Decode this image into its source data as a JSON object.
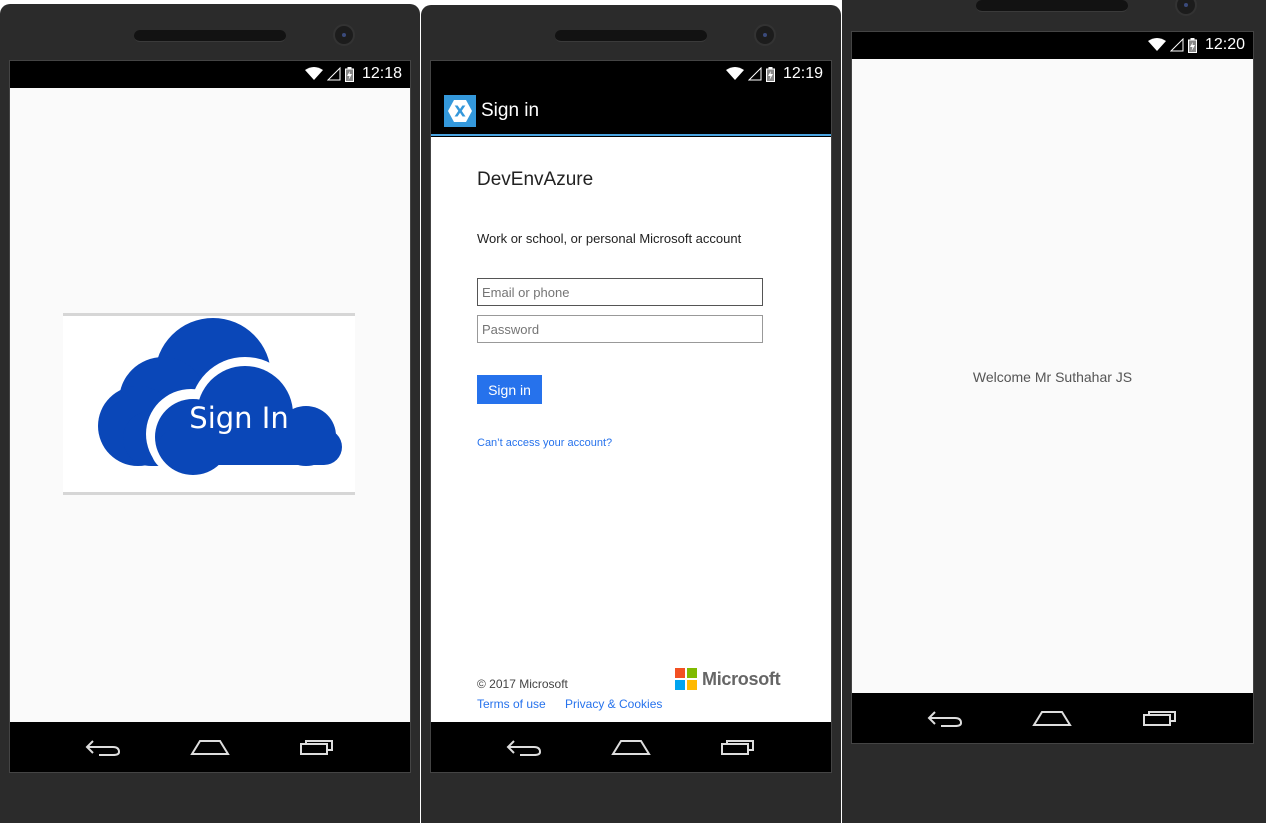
{
  "phones": [
    {
      "status": {
        "time": "12:18"
      },
      "signin_image": {
        "text": "Sign In",
        "cloud_color": "#0a47b8"
      }
    },
    {
      "status": {
        "time": "12:19"
      },
      "appbar": {
        "title": "Sign in",
        "logo_letter": "X",
        "logo_color": "#3498db"
      },
      "login": {
        "tenant": "DevEnvAzure",
        "account_desc": "Work or school, or personal Microsoft account",
        "email_placeholder": "Email or phone",
        "password_placeholder": "Password",
        "signin_label": "Sign in",
        "cant_access": "Can’t access your account?",
        "copyright": "© 2017 Microsoft",
        "terms": "Terms of use",
        "privacy": "Privacy & Cookies",
        "brand": "Microsoft",
        "accent": "#2672ec"
      }
    },
    {
      "status": {
        "time": "12:20"
      },
      "welcome": "Welcome Mr Suthahar JS"
    }
  ]
}
